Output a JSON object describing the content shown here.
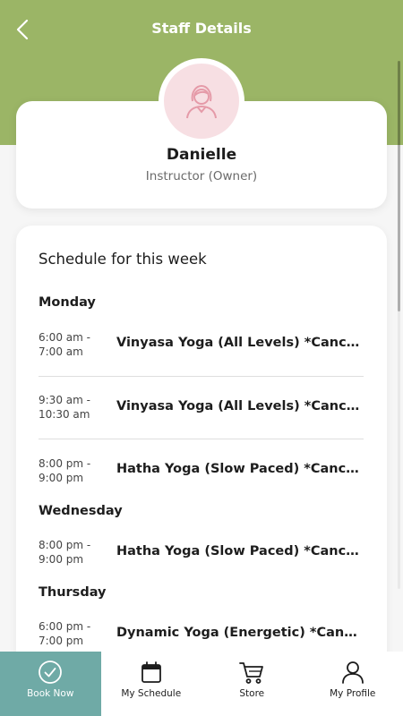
{
  "header": {
    "title": "Staff Details",
    "back_icon": "chevron-left-icon",
    "color": "#9bb566"
  },
  "profile": {
    "name": "Danielle",
    "role": "Instructor (Owner)",
    "avatar_icon": "person-icon",
    "avatar_bg": "#f7dfe3"
  },
  "schedule": {
    "title": "Schedule for this week",
    "days": [
      {
        "day": "Monday",
        "classes": [
          {
            "time_start": "6:00 am -",
            "time_end": "7:00 am",
            "name": "Vinyasa Yoga (All Levels) *Cancelled*"
          },
          {
            "time_start": "9:30 am -",
            "time_end": "10:30 am",
            "name": "Vinyasa Yoga (All Levels) *Cancelled*"
          },
          {
            "time_start": "8:00 pm -",
            "time_end": "9:00 pm",
            "name": "Hatha Yoga (Slow Paced) *Cancelled*"
          }
        ]
      },
      {
        "day": "Wednesday",
        "classes": [
          {
            "time_start": "8:00 pm -",
            "time_end": "9:00 pm",
            "name": "Hatha Yoga (Slow Paced) *Cancelled*"
          }
        ]
      },
      {
        "day": "Thursday",
        "classes": [
          {
            "time_start": "6:00 pm -",
            "time_end": "7:00 pm",
            "name": "Dynamic Yoga (Energetic) *Cancelled*"
          }
        ]
      }
    ]
  },
  "tabbar": {
    "active_color": "#6faaa6",
    "tabs": [
      {
        "label": "Book Now",
        "icon": "check-circle-icon",
        "active": true
      },
      {
        "label": "My Schedule",
        "icon": "calendar-icon",
        "active": false
      },
      {
        "label": "Store",
        "icon": "cart-icon",
        "active": false
      },
      {
        "label": "My Profile",
        "icon": "user-icon",
        "active": false
      }
    ]
  }
}
